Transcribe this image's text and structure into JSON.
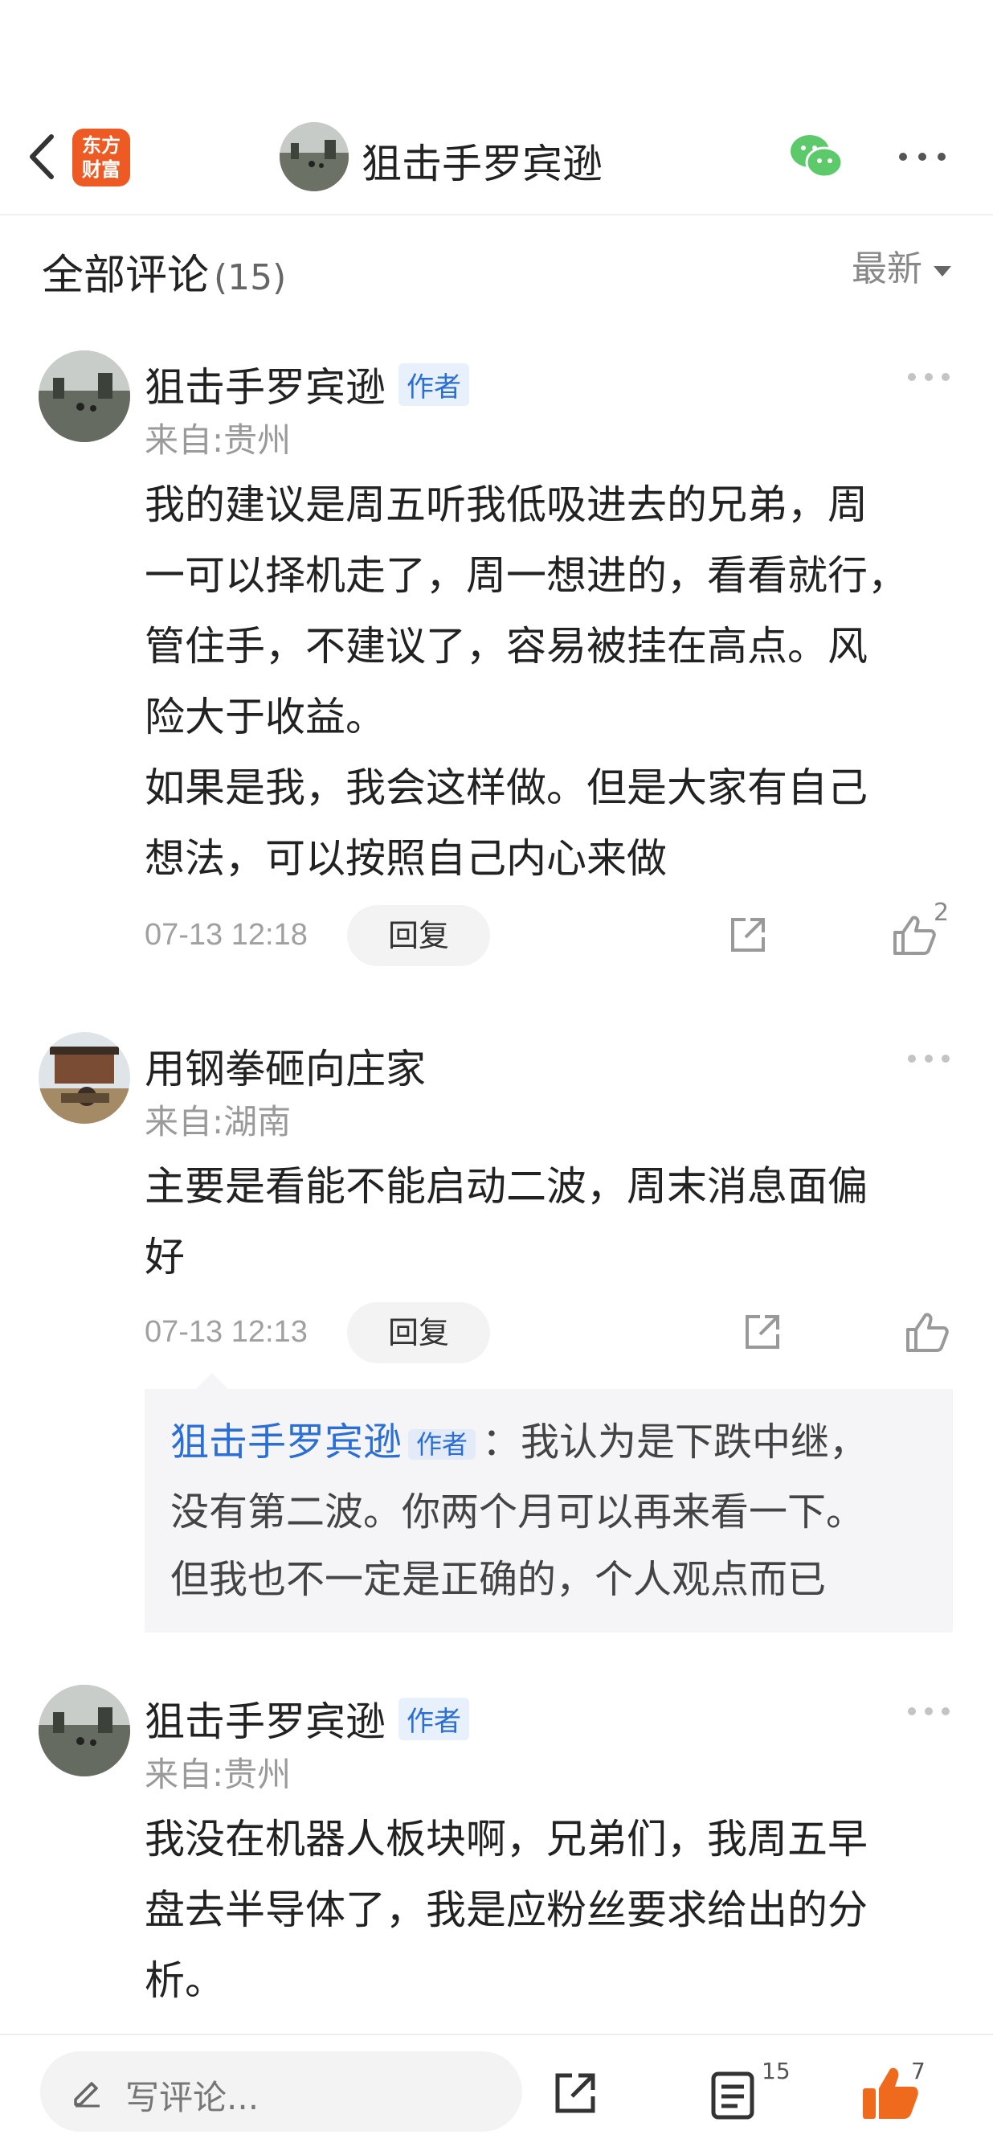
{
  "header": {
    "brand_line1": "东方",
    "brand_line2": "财富",
    "title": "狙击手罗宾逊"
  },
  "section": {
    "title": "全部评论",
    "count": "(15)",
    "sort_label": "最新"
  },
  "comments": [
    {
      "name": "狙击手罗宾逊",
      "tag": "作者",
      "location": "来自:贵州",
      "lines": [
        "我的建议是周五听我低吸进去的兄弟，周",
        "一可以择机走了，周一想进的，看看就行，",
        "管住手，不建议了，容易被挂在高点。风",
        "险大于收益。",
        "如果是我，我会这样做。但是大家有自己",
        "想法，可以按照自己内心来做"
      ],
      "time": "07-13 12:18",
      "reply_label": "回复",
      "likes": "2"
    },
    {
      "name": "用钢拳砸向庄家",
      "location": "来自:湖南",
      "lines": [
        "主要是看能不能启动二波，周末消息面偏",
        "好"
      ],
      "time": "07-13 12:13",
      "reply_label": "回复",
      "reply": {
        "name": "狙击手罗宾逊",
        "tag": "作者",
        "line1": "：我认为是下跌中继，",
        "line2": "没有第二波。你两个月可以再来看一下。",
        "line3": "但我也不一定是正确的，个人观点而已"
      }
    },
    {
      "name": "狙击手罗宾逊",
      "tag": "作者",
      "location": "来自:贵州",
      "lines": [
        "我没在机器人板块啊，兄弟们，我周五早",
        "盘去半导体了，我是应粉丝要求给出的分",
        "析。"
      ]
    }
  ],
  "bottom_bar": {
    "placeholder": "写评论...",
    "comment_count": "15",
    "like_count": "7"
  },
  "colors": {
    "accent_blue": "#2b6fd6",
    "brand_orange": "#ee5a24",
    "like_orange": "#f06a1d",
    "wechat_green": "#5cc96b"
  }
}
